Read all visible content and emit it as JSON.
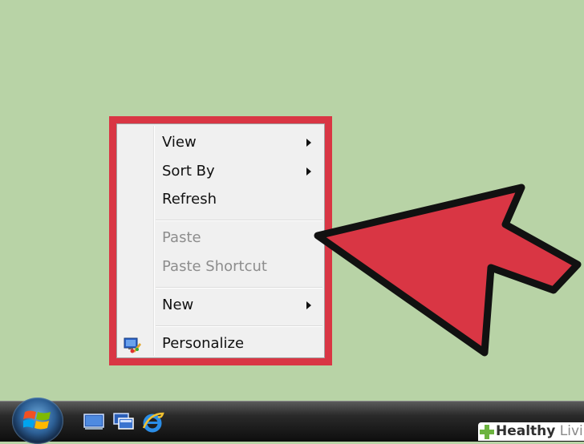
{
  "context_menu": {
    "items": [
      {
        "label": "View",
        "has_submenu": true,
        "enabled": true
      },
      {
        "label": "Sort By",
        "has_submenu": true,
        "enabled": true
      },
      {
        "label": "Refresh",
        "has_submenu": false,
        "enabled": true
      },
      {
        "label": "Paste",
        "has_submenu": false,
        "enabled": false
      },
      {
        "label": "Paste Shortcut",
        "has_submenu": false,
        "enabled": false
      },
      {
        "label": "New",
        "has_submenu": true,
        "enabled": true
      },
      {
        "label": "Personalize",
        "has_submenu": false,
        "enabled": true,
        "icon": "personalize-icon"
      }
    ]
  },
  "annotation": {
    "highlight_color": "#d93644",
    "arrow_color": "#d93644"
  },
  "taskbar": {
    "start_button_icon": "windows-logo-icon",
    "quick_launch": [
      "show-desktop-icon",
      "switch-windows-icon",
      "internet-explorer-icon"
    ]
  },
  "watermark": {
    "brand_bold": "Healthy",
    "brand_light": "Living"
  },
  "colors": {
    "desktop": "#b8d3a6",
    "menu_background": "#f0f0f0",
    "taskbar": "#1a1a1a"
  }
}
